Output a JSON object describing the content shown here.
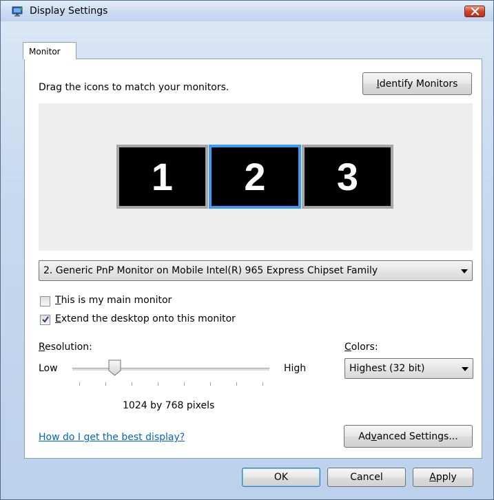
{
  "window": {
    "title": "Display Settings"
  },
  "tab": {
    "label": "Monitor"
  },
  "instructions": "Drag the icons to match your monitors.",
  "identify_button": {
    "pre": "",
    "accel": "I",
    "post": "dentify Monitors"
  },
  "monitors": [
    "1",
    "2",
    "3"
  ],
  "selected_monitor_index": 1,
  "monitor_select": {
    "value": "2. Generic PnP Monitor on Mobile Intel(R) 965 Express Chipset Family"
  },
  "checkbox_main": {
    "accel": "T",
    "rest": "his is my main monitor",
    "checked": false
  },
  "checkbox_extend": {
    "accel": "E",
    "rest": "xtend the desktop onto this monitor",
    "checked": true
  },
  "resolution": {
    "accel": "R",
    "rest": "esolution:",
    "low": "Low",
    "high": "High",
    "value_text": "1024 by 768 pixels"
  },
  "colors": {
    "accel": "C",
    "rest": "olors:",
    "value": "Highest (32 bit)"
  },
  "help_link": {
    "text": "How do I get the best display?"
  },
  "advanced_button": {
    "pre": "Ad",
    "accel": "v",
    "post": "anced Settings..."
  },
  "footer": {
    "ok": "OK",
    "cancel": "Cancel",
    "apply_accel": "A",
    "apply_rest": "pply"
  },
  "colors_palette": {
    "accent": "#3c9cf5",
    "link": "#0066cc",
    "monitor_border": "#a6a6a6"
  }
}
